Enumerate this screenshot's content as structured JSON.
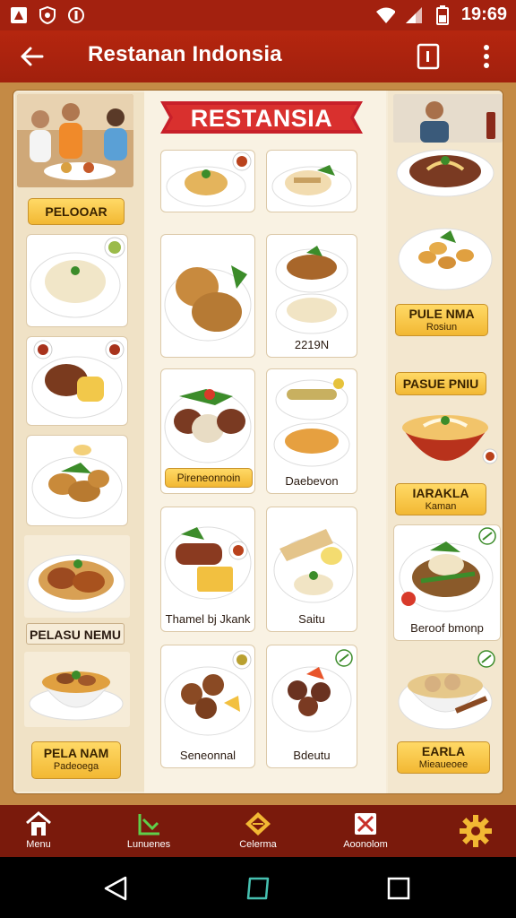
{
  "status_bar": {
    "time": "19:69"
  },
  "app_bar": {
    "title": "Restanan Indonsia"
  },
  "banner": {
    "text": "RESTANSIA"
  },
  "left_column": {
    "tag_top": "PELOOAR",
    "tag_mid": "PELASU NEMU",
    "tag_bottom": {
      "line1": "PELA NAM",
      "line2": "Padeoega"
    }
  },
  "middle_column": {
    "labels": {
      "r2c2": "2219N",
      "r3c1": "Pireneonnoin",
      "r3c2": "Daebevon",
      "r4c1": "Thamel bj Jkank",
      "r4c2": "Saitu",
      "r5c1": "Seneonnal",
      "r5c2": "Bdeutu"
    }
  },
  "right_column": {
    "tag1": {
      "line1": "PULE NMA",
      "line2": "Rosiun"
    },
    "tag2": "PASUE PNIU",
    "tag3": {
      "line1": "IARAKLA",
      "line2": "Kaman"
    },
    "label4": "Beroof bmonp",
    "tag5": {
      "line1": "EARLA",
      "line2": "Mieaueoee"
    }
  },
  "bottom_nav": {
    "items": [
      {
        "label": "Menu",
        "icon": "home-icon"
      },
      {
        "label": "Lunuenes",
        "icon": "chart-icon"
      },
      {
        "label": "Celerma",
        "icon": "diamond-icon"
      },
      {
        "label": "Aoonolom",
        "icon": "box-icon"
      },
      {
        "label": "",
        "icon": "gear-icon"
      }
    ]
  },
  "colors": {
    "primary": "#a3210f",
    "gold": "#f2b833",
    "panel": "#f6ecd8"
  }
}
